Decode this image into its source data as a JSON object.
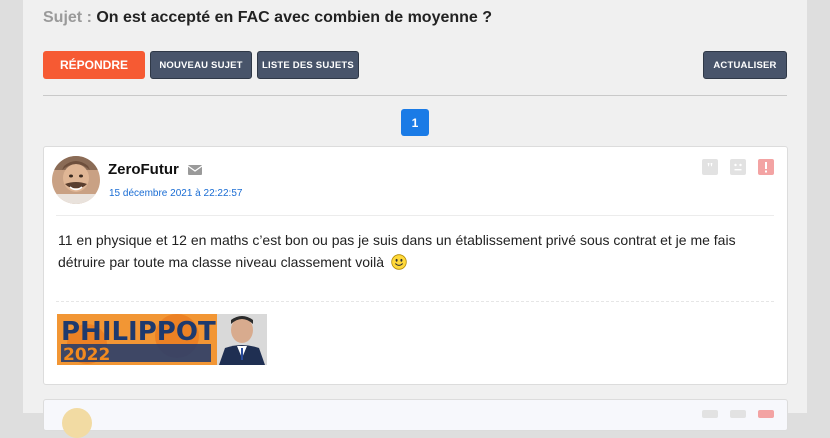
{
  "topic": {
    "label": "Sujet :",
    "title": "On est accepté en FAC avec combien de moyenne ?"
  },
  "toolbar": {
    "reply": "RÉPONDRE",
    "new_topic": "NOUVEAU SUJET",
    "topic_list": "LISTE DES SUJETS",
    "refresh": "ACTUALISER"
  },
  "pagination": {
    "current_page": "1"
  },
  "post": {
    "author": "ZeroFutur",
    "date": "15 décembre 2021 à 22:22:57",
    "message": "11 en physique et 12 en maths c’est bon ou pas je suis dans un établissement privé sous contrat et je me fais détruire par toute ma classe niveau classement voilà",
    "signature_text": "PHILIPPOT"
  },
  "colors": {
    "reply_button": "#f65a33",
    "dark_button": "#48546a",
    "page_button": "#1a7be6",
    "date_link": "#1a6dd4",
    "alert_icon": "#f3a3a3"
  },
  "icons": {
    "mail": "mail-icon",
    "quote": "quote-icon",
    "smiley_action": "smiley-icon",
    "report": "alert-icon",
    "message_smiley": "smiley-emoji-icon"
  }
}
